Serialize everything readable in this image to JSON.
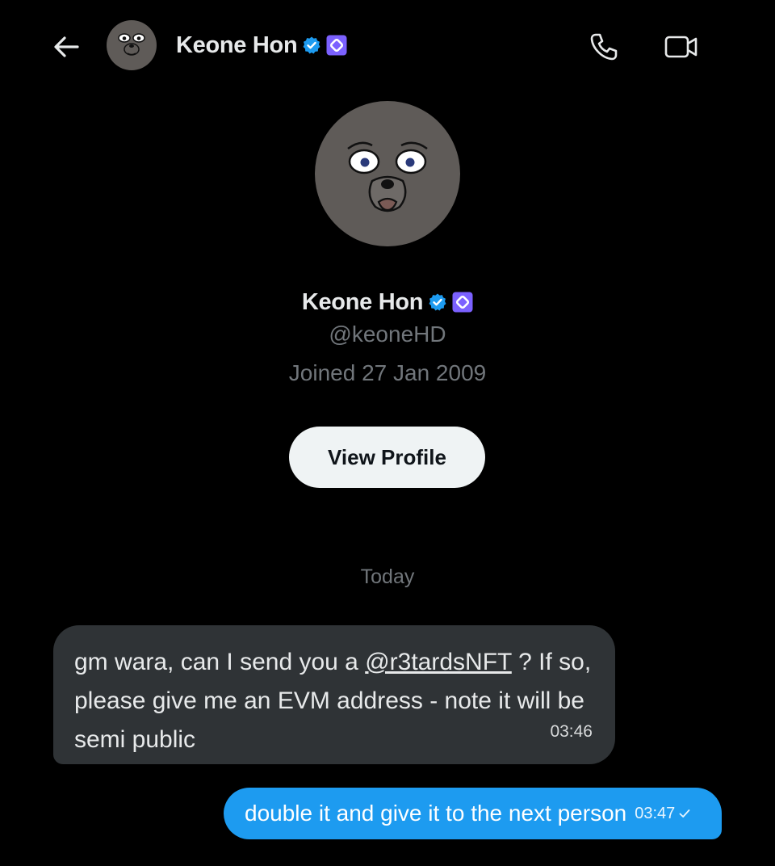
{
  "header": {
    "name": "Keone Hon",
    "back_icon": "arrow-left-icon",
    "phone_icon": "phone-icon",
    "video_icon": "video-camera-icon"
  },
  "profile": {
    "name": "Keone Hon",
    "handle": "@keoneHD",
    "joined": "Joined 27 Jan 2009",
    "view_profile_label": "View Profile",
    "verified_color": "#1d9bf0",
    "affiliate_badge_color": "#7b61ff"
  },
  "divider": {
    "today": "Today"
  },
  "messages": [
    {
      "direction": "incoming",
      "text_before": "gm wara, can I send you a ",
      "mention": "@r3tardsNFT",
      "text_after": " ? If so, please give me an EVM address - note it will be semi public",
      "time": "03:46"
    },
    {
      "direction": "outgoing",
      "text": "double it and give it to the next person",
      "time": "03:47"
    }
  ]
}
